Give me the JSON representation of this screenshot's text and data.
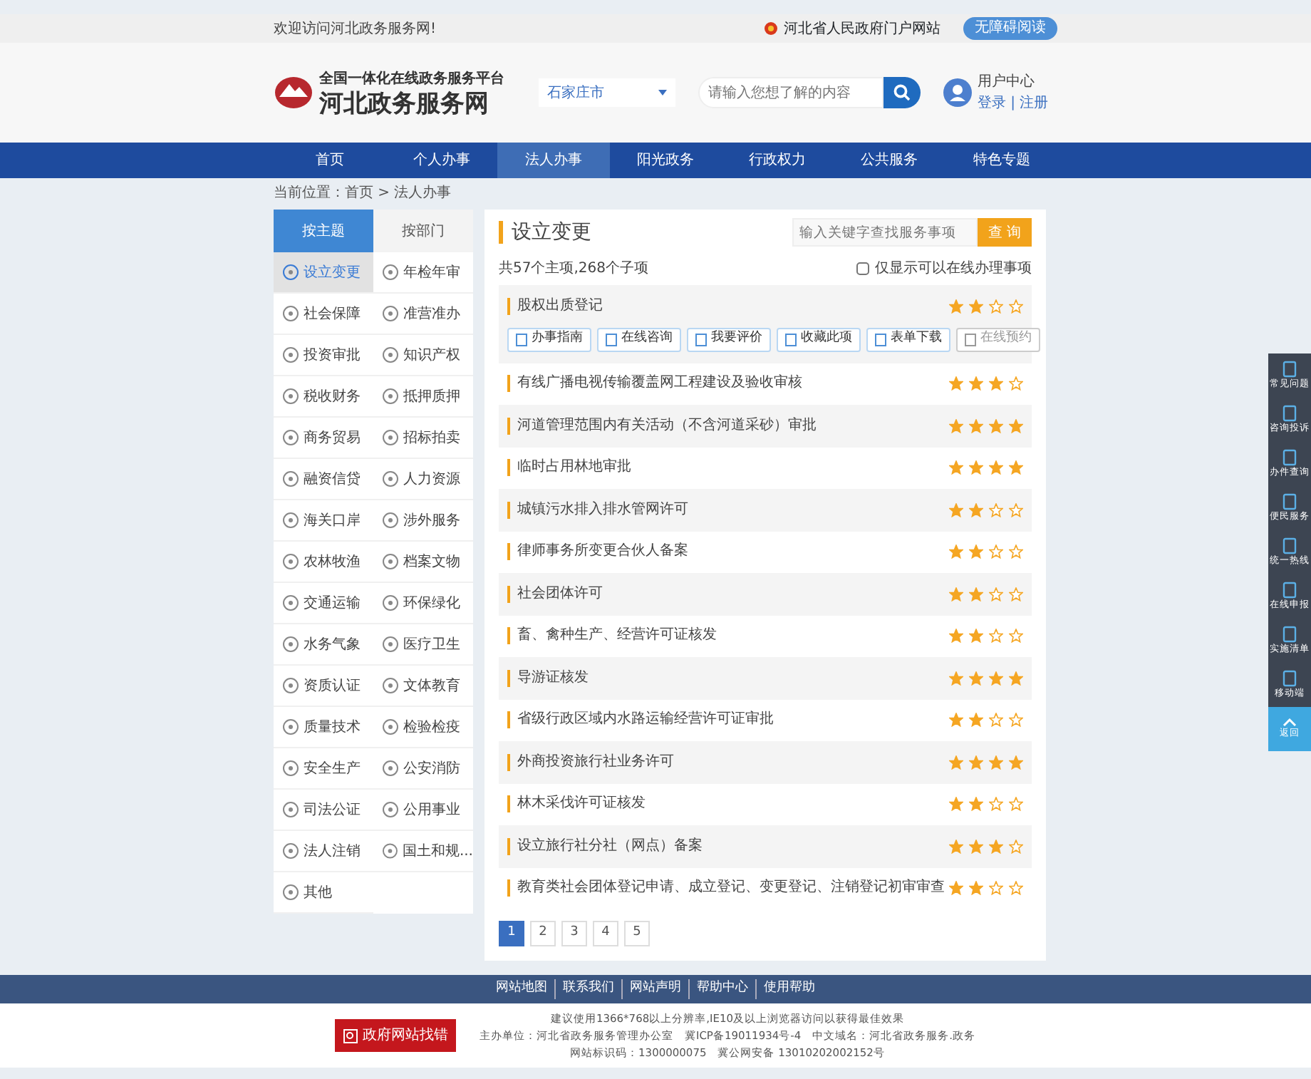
{
  "top_bar": {
    "welcome": "欢迎访问河北政务服务网!",
    "portal_link": "河北省人民政府门户网站",
    "accessibility_button": "无障碍阅读"
  },
  "header": {
    "platform_subtitle": "全国一体化在线政务服务平台",
    "site_name": "河北政务服务网",
    "region_select": "石家庄市",
    "search": {
      "placeholder": "请输入您想了解的内容"
    },
    "user": {
      "title": "用户中心",
      "links": "登录 | 注册"
    }
  },
  "nav": [
    {
      "label": "首页",
      "selected": false
    },
    {
      "label": "个人办事",
      "selected": false
    },
    {
      "label": "法人办事",
      "selected": true
    },
    {
      "label": "阳光政务",
      "selected": false
    },
    {
      "label": "行政权力",
      "selected": false
    },
    {
      "label": "公共服务",
      "selected": false
    },
    {
      "label": "特色专题",
      "selected": false
    }
  ],
  "breadcrumb": "当前位置：首页 > 法人办事",
  "sidebar": {
    "tabs": [
      {
        "label": "按主题",
        "selected": true
      },
      {
        "label": "按部门",
        "selected": false
      }
    ],
    "topics": [
      {
        "label": "设立变更",
        "selected": true
      },
      {
        "label": "年检年审",
        "selected": false
      },
      {
        "label": "社会保障",
        "selected": false
      },
      {
        "label": "准营准办",
        "selected": false
      },
      {
        "label": "投资审批",
        "selected": false
      },
      {
        "label": "知识产权",
        "selected": false
      },
      {
        "label": "税收财务",
        "selected": false
      },
      {
        "label": "抵押质押",
        "selected": false
      },
      {
        "label": "商务贸易",
        "selected": false
      },
      {
        "label": "招标拍卖",
        "selected": false
      },
      {
        "label": "融资信贷",
        "selected": false
      },
      {
        "label": "人力资源",
        "selected": false
      },
      {
        "label": "海关口岸",
        "selected": false
      },
      {
        "label": "涉外服务",
        "selected": false
      },
      {
        "label": "农林牧渔",
        "selected": false
      },
      {
        "label": "档案文物",
        "selected": false
      },
      {
        "label": "交通运输",
        "selected": false
      },
      {
        "label": "环保绿化",
        "selected": false
      },
      {
        "label": "水务气象",
        "selected": false
      },
      {
        "label": "医疗卫生",
        "selected": false
      },
      {
        "label": "资质认证",
        "selected": false
      },
      {
        "label": "文体教育",
        "selected": false
      },
      {
        "label": "质量技术",
        "selected": false
      },
      {
        "label": "检验检疫",
        "selected": false
      },
      {
        "label": "安全生产",
        "selected": false
      },
      {
        "label": "公安消防",
        "selected": false
      },
      {
        "label": "司法公证",
        "selected": false
      },
      {
        "label": "公用事业",
        "selected": false
      },
      {
        "label": "法人注销",
        "selected": false
      },
      {
        "label": "国土和规...",
        "selected": false
      },
      {
        "label": "其他",
        "selected": false
      }
    ]
  },
  "content": {
    "title": "设立变更",
    "search": {
      "placeholder": "输入关键字查找服务事项"
    },
    "search_button": "查 询",
    "summary": "共57个主项,268个子项",
    "online_only": {
      "label": "仅显示可以在线办理事项",
      "checked": false
    },
    "items": [
      {
        "title": "股权出质登记",
        "stars": 2,
        "expanded": true,
        "actions": [
          {
            "label": "办事指南",
            "disabled": false
          },
          {
            "label": "在线咨询",
            "disabled": false
          },
          {
            "label": "我要评价",
            "disabled": false
          },
          {
            "label": "收藏此项",
            "disabled": false
          },
          {
            "label": "表单下载",
            "disabled": false
          },
          {
            "label": "在线预约",
            "disabled": true
          }
        ]
      },
      {
        "title": "有线广播电视传输覆盖网工程建设及验收审核",
        "stars": 3,
        "expanded": false
      },
      {
        "title": "河道管理范围内有关活动（不含河道采砂）审批",
        "stars": 4,
        "expanded": false
      },
      {
        "title": "临时占用林地审批",
        "stars": 4,
        "expanded": false
      },
      {
        "title": "城镇污水排入排水管网许可",
        "stars": 2,
        "expanded": false
      },
      {
        "title": "律师事务所变更合伙人备案",
        "stars": 2,
        "expanded": false
      },
      {
        "title": "社会团体许可",
        "stars": 2,
        "expanded": false
      },
      {
        "title": "畜、禽种生产、经营许可证核发",
        "stars": 2,
        "expanded": false
      },
      {
        "title": "导游证核发",
        "stars": 4,
        "expanded": false
      },
      {
        "title": "省级行政区域内水路运输经营许可证审批",
        "stars": 2,
        "expanded": false
      },
      {
        "title": "外商投资旅行社业务许可",
        "stars": 4,
        "expanded": false
      },
      {
        "title": "林木采伐许可证核发",
        "stars": 2,
        "expanded": false
      },
      {
        "title": "设立旅行社分社（网点）备案",
        "stars": 3,
        "expanded": false
      },
      {
        "title": "教育类社会团体登记申请、成立登记、变更登记、注销登记初审审查",
        "stars": 2,
        "expanded": false
      }
    ],
    "pagination": [
      {
        "label": "1",
        "selected": true
      },
      {
        "label": "2",
        "selected": false
      },
      {
        "label": "3",
        "selected": false
      },
      {
        "label": "4",
        "selected": false
      },
      {
        "label": "5",
        "selected": false
      }
    ]
  },
  "float_toolbar": [
    {
      "label": "常见问题"
    },
    {
      "label": "咨询投诉"
    },
    {
      "label": "办件查询"
    },
    {
      "label": "便民服务"
    },
    {
      "label": "统一热线"
    },
    {
      "label": "在线申报"
    },
    {
      "label": "实施清单"
    },
    {
      "label": "移动端"
    }
  ],
  "back_to_top": "返回",
  "footer": {
    "links": [
      "网站地图",
      "联系我们",
      "网站声明",
      "帮助中心",
      "使用帮助"
    ],
    "badge": "政府网站找错",
    "lines": [
      "建议使用1366*768以上分辨率,IE10及以上浏览器访问以获得最佳效果",
      "主办单位：河北省政务服务管理办公室　冀ICP备19011934号-4　中文域名：河北省政务服务.政务",
      "网站标识码：1300000075　冀公网安备 13010202002152号"
    ]
  }
}
